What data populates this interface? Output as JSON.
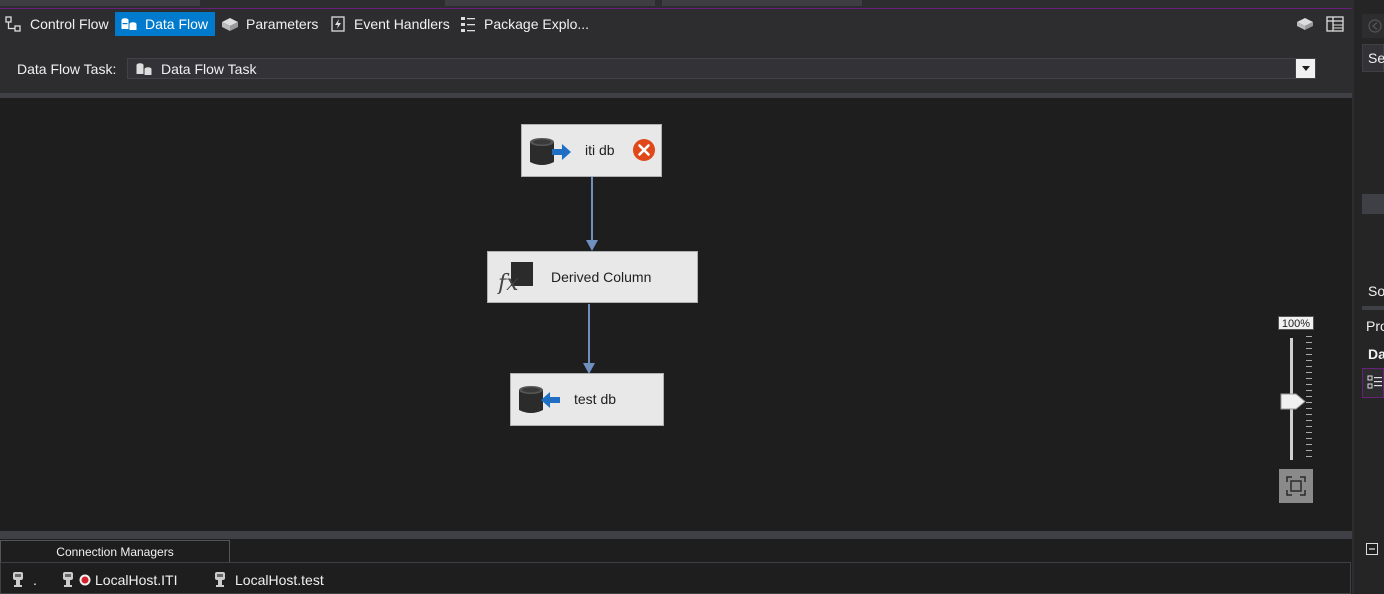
{
  "tabs": [
    {
      "label": "Control Flow",
      "icon": "control-flow-icon",
      "active": false
    },
    {
      "label": "Data Flow",
      "icon": "data-flow-icon",
      "active": true
    },
    {
      "label": "Parameters",
      "icon": "parameters-icon",
      "active": false
    },
    {
      "label": "Event Handlers",
      "icon": "event-handlers-icon",
      "active": false
    },
    {
      "label": "Package Explo...",
      "icon": "package-explorer-icon",
      "active": false
    }
  ],
  "toolbar_right": [
    {
      "icon": "variables-icon"
    },
    {
      "icon": "grid-view-icon"
    }
  ],
  "task_selector": {
    "label": "Data Flow Task:",
    "value": "Data Flow Task"
  },
  "components": [
    {
      "label": "iti db",
      "icon": "ole-db-source-icon",
      "error": true,
      "error_icon": "error-icon"
    },
    {
      "label": "Derived Column",
      "icon": "derived-column-fx-icon",
      "error": false
    },
    {
      "label": "test db",
      "icon": "ole-db-destination-icon",
      "error": false
    }
  ],
  "zoom": {
    "label": "100%",
    "level_percent": 100
  },
  "connection_managers": {
    "tab_label": "Connection Managers",
    "items": [
      {
        "label": ".",
        "error": false
      },
      {
        "label": "LocalHost.ITI",
        "error": true
      },
      {
        "label": "LocalHost.test",
        "error": false
      }
    ]
  },
  "right_panel": {
    "fragments": [
      "Se",
      "So",
      "Pro",
      "Da"
    ]
  },
  "colors": {
    "accent": "#007acc",
    "background": "#1e1e1e",
    "flow_arrow": "#6f8fbf",
    "error": "#e0481b",
    "component_face": "#e8e8e8"
  }
}
